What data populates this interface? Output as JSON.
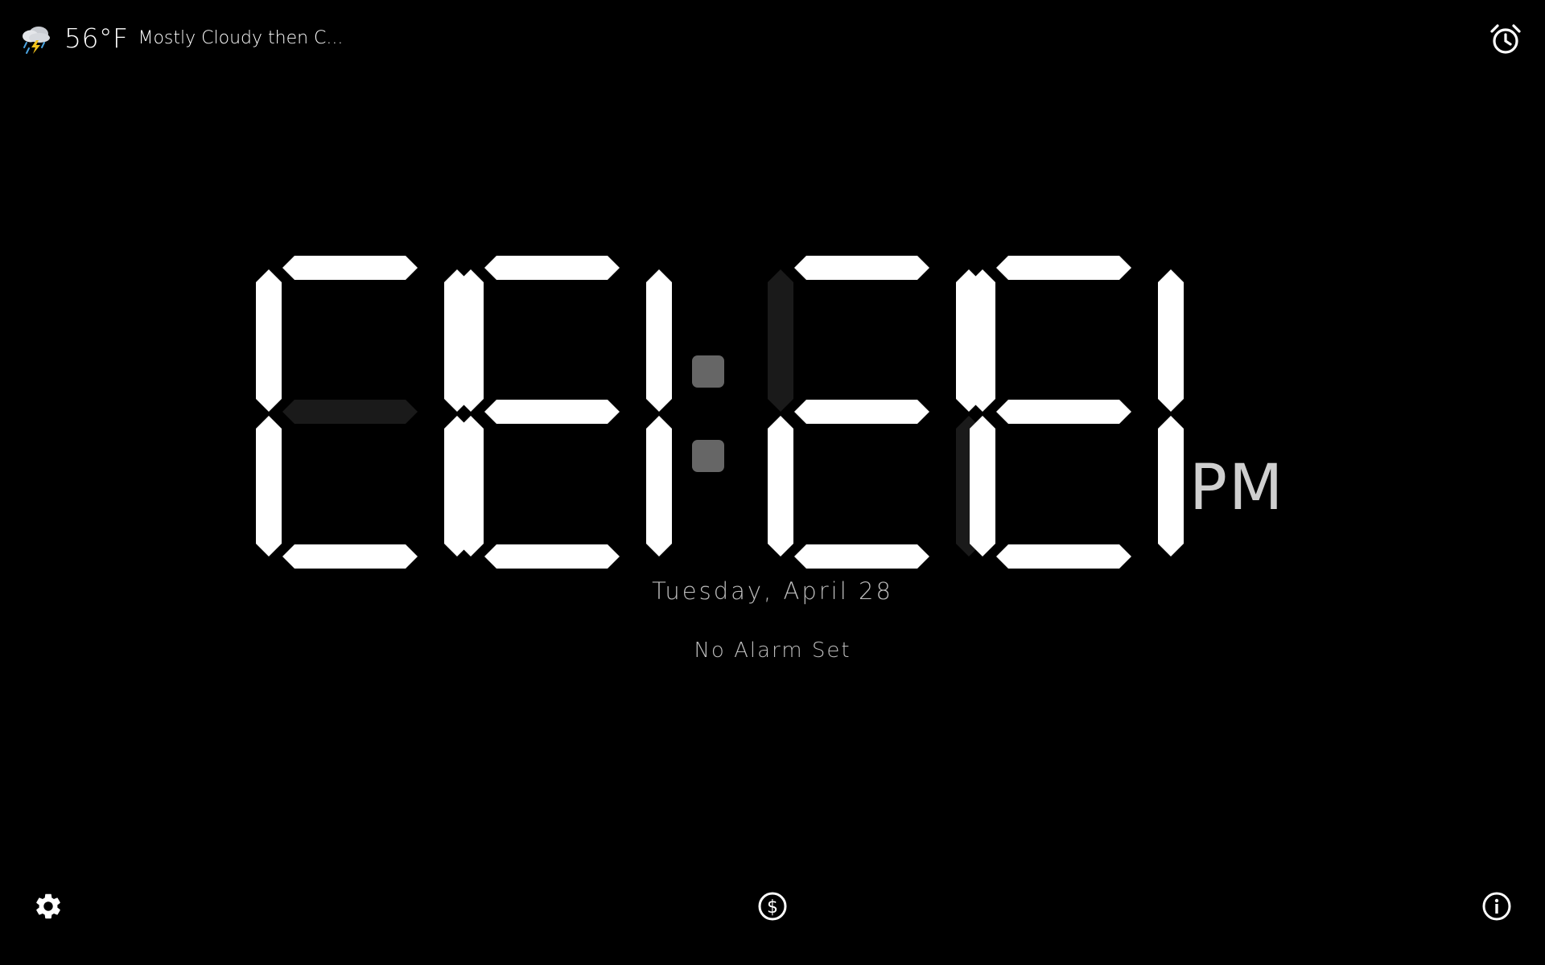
{
  "weather": {
    "icon": "thunderstorm-rain-icon",
    "temperature": "56°F",
    "condition": "Mostly Cloudy then C..."
  },
  "clock": {
    "time": "08:28",
    "period": "PM",
    "segment_on_color": "#ffffff",
    "segment_off_color": "#1a1a1a",
    "colon_color": "#666666"
  },
  "date": "Tuesday, April 28",
  "alarm_status": "No Alarm Set",
  "icons": {
    "alarm": "alarm-clock-icon",
    "settings": "gear-icon",
    "donate": "dollar-circle-icon",
    "info": "info-circle-icon"
  }
}
